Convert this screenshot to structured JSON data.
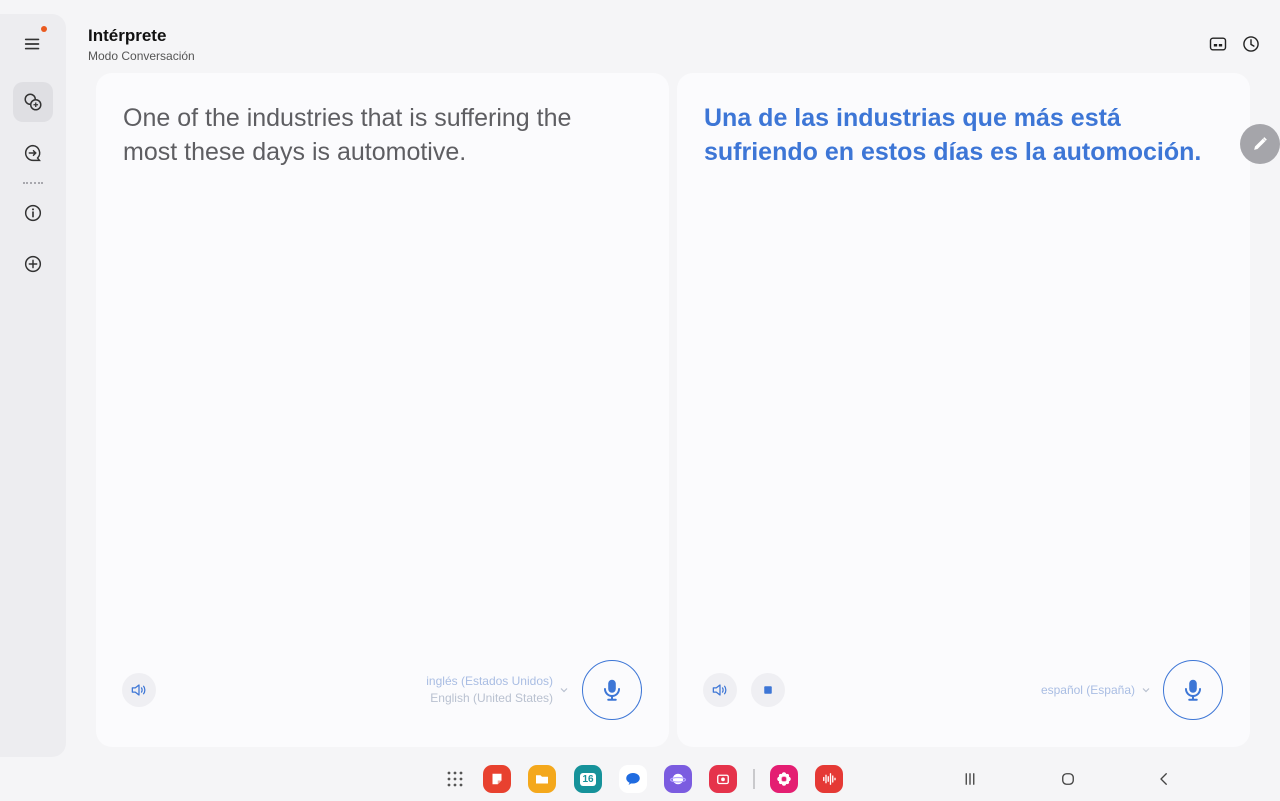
{
  "header": {
    "title": "Intérprete",
    "subtitle": "Modo Conversación"
  },
  "sidebar": {
    "items": [
      {
        "icon": "menu-icon",
        "badge": true
      },
      {
        "icon": "conversation-icon",
        "active": true
      },
      {
        "icon": "chat-arrow-icon"
      },
      {
        "icon": "info-icon"
      },
      {
        "icon": "add-icon"
      }
    ]
  },
  "header_actions": [
    {
      "icon": "split-screen-icon"
    },
    {
      "icon": "history-icon"
    }
  ],
  "left_panel": {
    "text": "One of the industries that is suffering the most these days is automotive.",
    "language_primary": "inglés (Estados Unidos)",
    "language_secondary": "English (United States)"
  },
  "right_panel": {
    "text": "Una de las industrias que más está sufriendo en estos días es la automoción.",
    "language_primary": "español (España)"
  },
  "taskbar": {
    "calendar_day": "16",
    "apps": [
      "app-drawer-icon",
      "notes-app-icon",
      "files-app-icon",
      "calendar-app-icon",
      "messages-app-icon",
      "internet-app-icon",
      "screen-recorder-app-icon",
      "flower-app-icon",
      "voice-recorder-app-icon"
    ]
  },
  "colors": {
    "accent": "#3d76d6",
    "background": "#f5f5f7",
    "panel": "#fbfbfd",
    "badge": "#ea5a1f"
  }
}
